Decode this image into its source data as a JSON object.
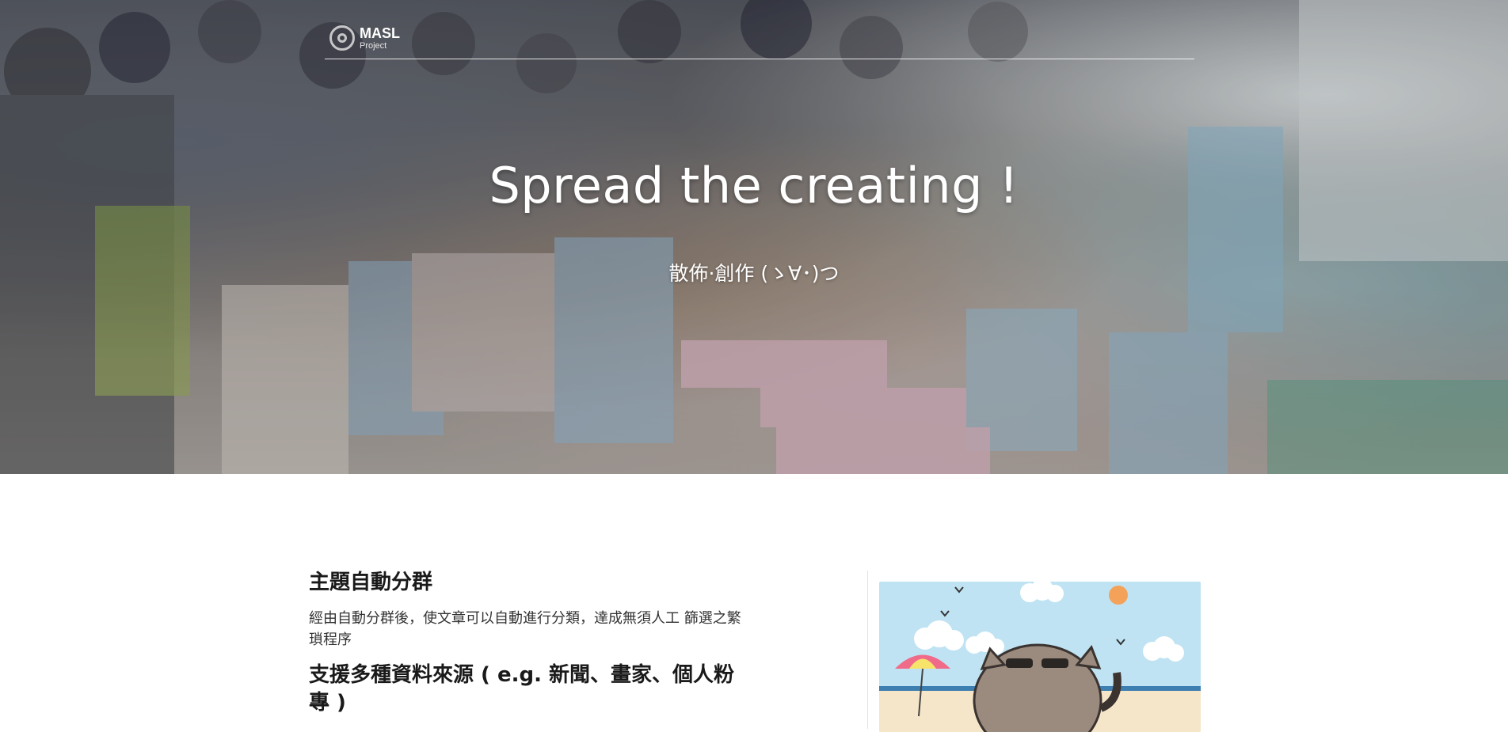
{
  "brand": {
    "name": "MASL",
    "sub": "Project"
  },
  "hero": {
    "title": "Spread the creating !",
    "subtitle": "散佈·創作 (ゝ∀･)つ"
  },
  "features": [
    {
      "heading": "主題自動分群",
      "description": "經由自動分群後，使文章可以自動進行分類，達成無須人工 篩選之繁瑣程序"
    },
    {
      "heading": "支援多種資料來源 ( e.g. 新聞、畫家、個人粉專 )",
      "description": ""
    }
  ],
  "icons": {
    "logo": "masl-logo-icon"
  },
  "colors": {
    "hero_text": "#ffffff",
    "heading": "#1a1a1a",
    "body_text": "#333333",
    "sky": "#bfe3f2",
    "sun": "#f4a259"
  }
}
